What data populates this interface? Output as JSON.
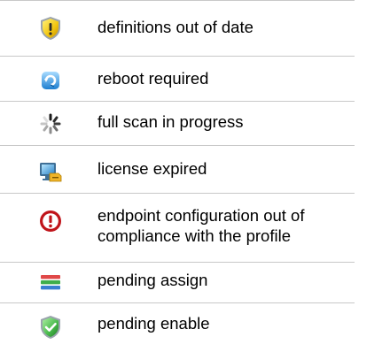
{
  "legend": {
    "items": [
      {
        "icon": "warning-shield-icon",
        "label": "definitions out of date"
      },
      {
        "icon": "reboot-icon",
        "label": "reboot required"
      },
      {
        "icon": "spinner-icon",
        "label": "full scan in progress"
      },
      {
        "icon": "license-expired-icon",
        "label": "license expired"
      },
      {
        "icon": "error-circle-icon",
        "label_line1": "endpoint configuration out of",
        "label_line2": "compliance with the profile"
      },
      {
        "icon": "pending-assign-icon",
        "label": "pending assign"
      },
      {
        "icon": "check-shield-icon",
        "label": "pending enable"
      }
    ]
  }
}
